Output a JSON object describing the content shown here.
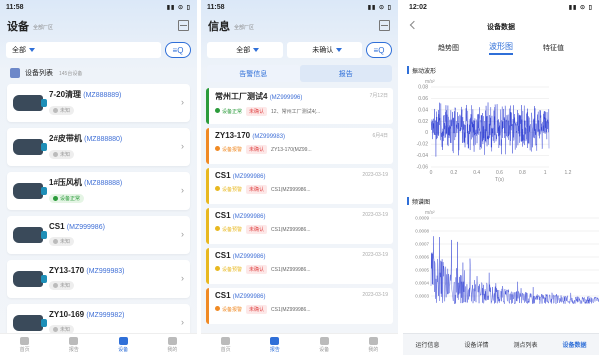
{
  "screen1": {
    "time": "11:58",
    "title": "设备",
    "subtitle": "全部厂区",
    "filter": "全部",
    "list_title": "设备列表",
    "count": "145台设备",
    "devices": [
      {
        "name": "7-20清理",
        "code": "(MZ888889)",
        "status": "未知"
      },
      {
        "name": "2#皮带机",
        "code": "(MZ888880)",
        "status": "未知"
      },
      {
        "name": "1#压风机",
        "code": "(MZ888888)",
        "status": "设备正常"
      },
      {
        "name": "CS1",
        "code": "(MZ999986)",
        "status": "未知"
      },
      {
        "name": "ZY13-170",
        "code": "(MZ999983)",
        "status": "未知"
      },
      {
        "name": "ZY10-169",
        "code": "(MZ999982)",
        "status": "未知"
      }
    ],
    "tabs": [
      "首页",
      "报告",
      "设备",
      "我的"
    ]
  },
  "screen2": {
    "time": "11:58",
    "title": "信息",
    "subtitle": "全部厂区",
    "filter1": "全部",
    "filter2": "未确认",
    "seg": [
      "告警信息",
      "报告"
    ],
    "alarms": [
      {
        "name": "常州工厂测试4",
        "code": "(MZ999996)",
        "date": "7月12日",
        "status": "设备正常",
        "tag": "未确认",
        "desc": "12、常州工厂测试4(..."
      },
      {
        "name": "ZY13-170",
        "code": "(MZ999983)",
        "date": "6月4日",
        "status": "设备报警",
        "tag": "未确认",
        "desc": "ZY13-170(MZ99..."
      },
      {
        "name": "CS1",
        "code": "(MZ999986)",
        "date": "2023-03-19",
        "status": "设备预警",
        "tag": "未确认",
        "desc": "CS1(MZ999986..."
      },
      {
        "name": "CS1",
        "code": "(MZ999986)",
        "date": "2023-03-19",
        "status": "设备预警",
        "tag": "未确认",
        "desc": "CS1(MZ999986..."
      },
      {
        "name": "CS1",
        "code": "(MZ999986)",
        "date": "2023-03-19",
        "status": "设备预警",
        "tag": "未确认",
        "desc": "CS1(MZ999986..."
      },
      {
        "name": "CS1",
        "code": "(MZ999986)",
        "date": "2023-03-19",
        "status": "设备报警",
        "tag": "未确认",
        "desc": "CS1(MZ999986..."
      }
    ],
    "tabs": [
      "首页",
      "报告",
      "设备",
      "我的"
    ]
  },
  "screen3": {
    "time": "12:02",
    "title": "设备数据",
    "tabs": [
      "趋势图",
      "波形图",
      "特征值"
    ],
    "wave_title": "振动波形",
    "wave_yunit": "m/s²",
    "wave_xunit": "T(s)",
    "wave_yticks": [
      "0.08",
      "0.06",
      "0.04",
      "0.02",
      "0",
      "-0.02",
      "-0.04",
      "-0.06"
    ],
    "wave_xticks": [
      "0",
      "0.2",
      "0.4",
      "0.6",
      "0.8",
      "1",
      "1.2"
    ],
    "spec_title": "频谱图",
    "spec_yunit": "m/s²",
    "spec_yticks": [
      "0.0009",
      "0.0008",
      "0.0007",
      "0.0006",
      "0.0005",
      "0.0004",
      "0.0003"
    ],
    "bottom": [
      "运行信息",
      "设备详情",
      "测点列表",
      "设备数据"
    ]
  },
  "colors": {
    "accent": "#2f6fd8",
    "ok": "#2b9b3b",
    "warn": "#e8b820",
    "alarm": "#f08a24",
    "red": "#e04848"
  }
}
